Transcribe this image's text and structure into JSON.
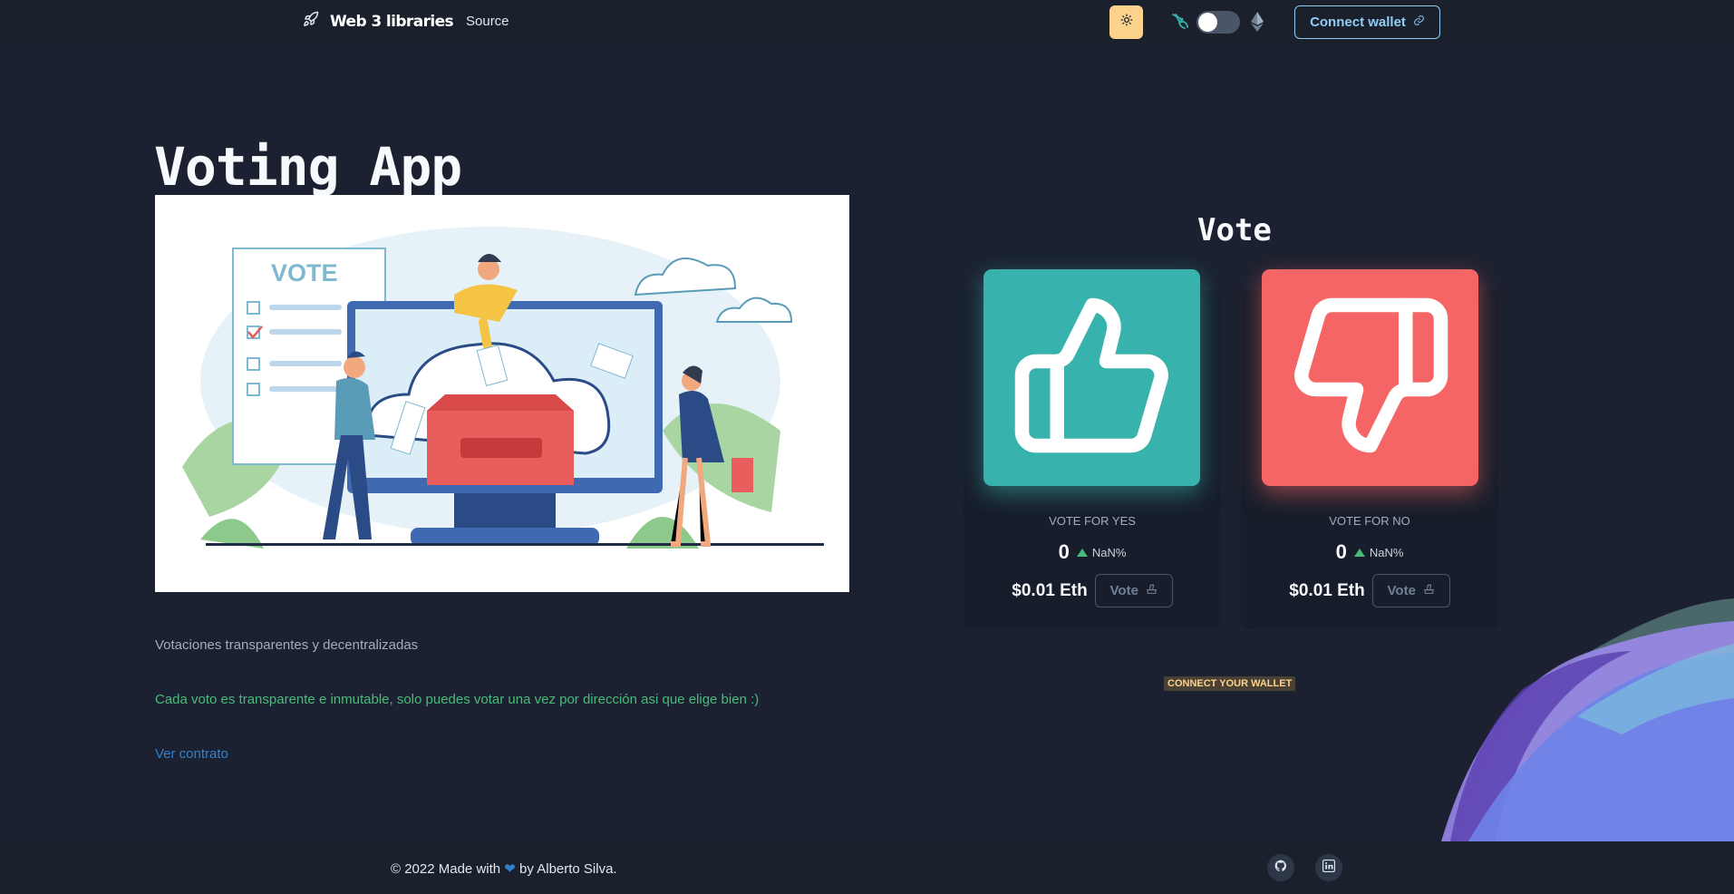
{
  "header": {
    "brand": "Web 3 libraries",
    "nav_source": "Source",
    "connect_label": "Connect wallet",
    "theme_toggle_icon": "sun-icon",
    "network_icons": [
      "uniswap-icon",
      "ethereum-icon"
    ]
  },
  "main": {
    "title": "Voting App",
    "illustration_caption": "VOTE",
    "subtitle": "Votaciones transparentes y decentralizadas",
    "note": "Cada voto es transparente e inmutable, solo puedes votar una vez por dirección asi que elige bien :)",
    "contract_link": "Ver contrato"
  },
  "vote": {
    "heading": "Vote",
    "yes": {
      "label": "VOTE FOR YES",
      "count": "0",
      "percent": "NaN%",
      "price": "$0.01 Eth",
      "button": "Vote",
      "icon": "thumbs-up-icon",
      "color": "#38b2ac"
    },
    "no": {
      "label": "VOTE FOR NO",
      "count": "0",
      "percent": "NaN%",
      "price": "$0.01 Eth",
      "button": "Vote",
      "icon": "thumbs-down-icon",
      "color": "#f56565"
    },
    "connect_notice": "CONNECT YOUR WALLET"
  },
  "footer": {
    "prefix": "© 2022 Made with",
    "suffix": "by Alberto Silva.",
    "social_icons": [
      "github-icon",
      "linkedin-icon"
    ]
  }
}
